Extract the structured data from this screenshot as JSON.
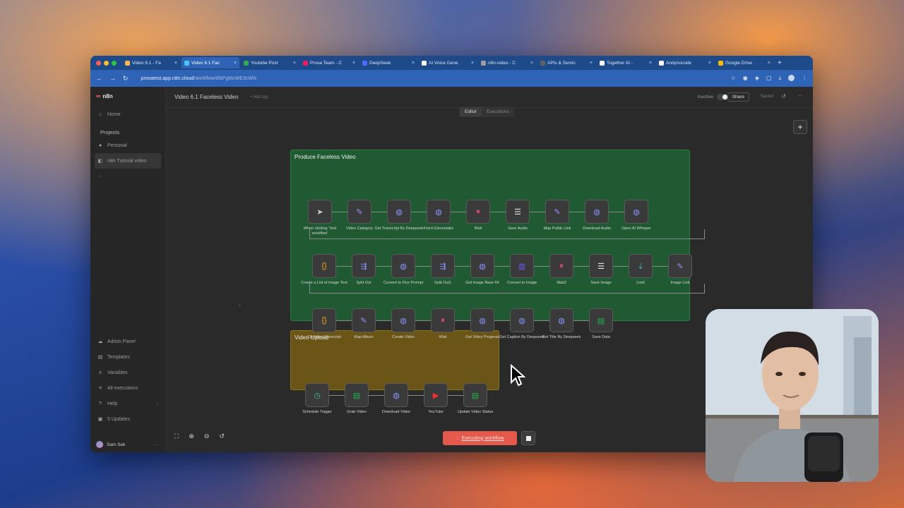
{
  "browser": {
    "tabs": [
      {
        "title": "Video 6.1 - Fa",
        "color": "#ffb74d"
      },
      {
        "title": "Video 6.1 Fac",
        "color": "#4fc3f7",
        "active": true
      },
      {
        "title": "Youtube Post",
        "color": "#34a853"
      },
      {
        "title": "Proxa Team - C",
        "color": "#e91e63"
      },
      {
        "title": "DeepSeek",
        "color": "#4d6bfe"
      },
      {
        "title": "AI Voice Gene",
        "color": "#ffffff"
      },
      {
        "title": "n8n-video - C",
        "color": "#9e9e9e"
      },
      {
        "title": "APIs & Servic",
        "color": "#5f6368"
      },
      {
        "title": "Together AI -",
        "color": "#ffffff"
      },
      {
        "title": "Andynocode",
        "color": "#ffffff"
      },
      {
        "title": "Google Drive",
        "color": "#fbbc04"
      }
    ],
    "url_host": "proxatest.app.n8n.cloud",
    "url_path": "/workflow/9IkPgMcWE3cWN"
  },
  "sidebar": {
    "logo": "n8n",
    "home": "Home",
    "projects_heading": "Projects",
    "personal": "Personal",
    "project": "n8n Tutorial video",
    "bottom": [
      "Admin Panel",
      "Templates",
      "Variables",
      "All executions",
      "Help",
      "5 Updates"
    ],
    "user": "Sam Sek"
  },
  "topbar": {
    "workflow_title": "Video 6.1 Faceless Video",
    "add_tag": "+ Add tag",
    "inactive": "Inactive",
    "share": "Share",
    "saved": "Saved",
    "mode_tabs": [
      "Editor",
      "Executions"
    ]
  },
  "groups": {
    "g1_title": "Produce Faceless Video",
    "g2_title": "Video Upload",
    "row1": [
      "When clicking 'Test workflow'",
      "Video Category",
      "Get Transcript By Deepseek",
      "Fetch Elevenlabs",
      "Wait",
      "Save Audio",
      "Map Public Link",
      "Download Audio",
      "Open AI Whisper"
    ],
    "row2": [
      "Create a List of Image Text",
      "Split Out",
      "Convert to Flux Prompt",
      "Split Out1",
      "Get Image Base 64",
      "Convert to Image",
      "Wait2",
      "Save Image",
      "Limit",
      "Image Link"
    ],
    "row3": [
      "Combine Transcript",
      "Map Album",
      "Create Video",
      "Wait",
      "Get Video Progress",
      "Get Caption By Deepseek",
      "Get Title By Deepseek",
      "Save Data"
    ],
    "row4": [
      "Schedule Trigger",
      "Grab Video",
      "Download Video",
      "YouTube",
      "Update Video Status"
    ]
  },
  "footer": {
    "executing": "Executing workflow"
  }
}
